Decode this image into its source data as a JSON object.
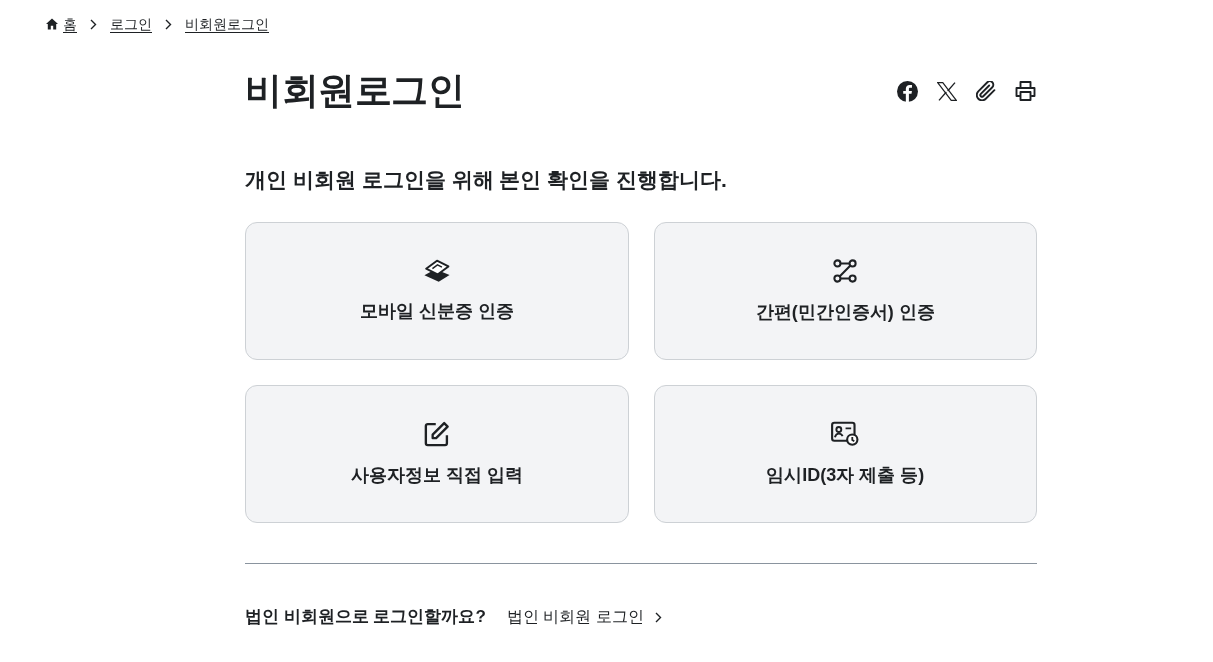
{
  "breadcrumb": [
    "홈",
    "로그인",
    "비회원로그인"
  ],
  "title": "비회원로그인",
  "subtitle": "개인 비회원 로그인을 위해 본인 확인을 진행합니다.",
  "options": [
    "모바일 신분증 인증",
    "간편(민간인증서) 인증",
    "사용자정보 직접 입력",
    "임시ID(3자 제출 등)"
  ],
  "corporate": {
    "question": "법인 비회원으로 로그인할까요?",
    "link": "법인 비회원 로그인"
  }
}
